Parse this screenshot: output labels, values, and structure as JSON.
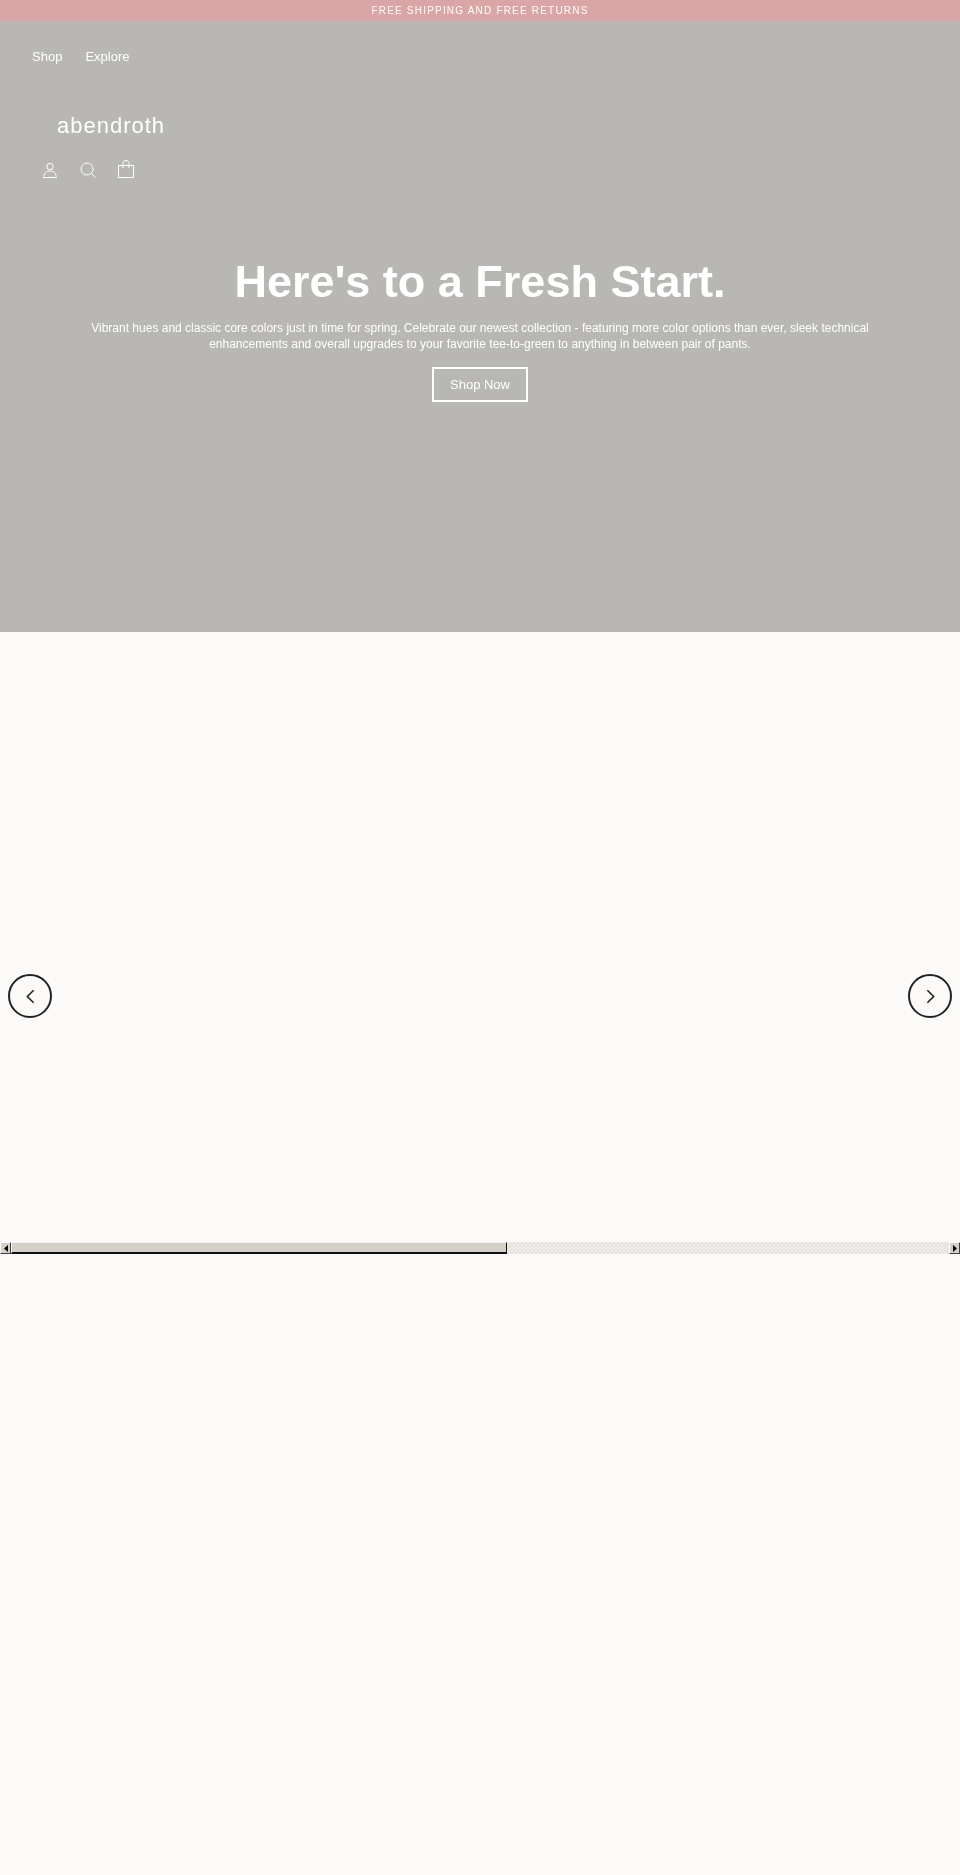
{
  "announcement_bar": {
    "text": "FREE SHIPPING AND FREE RETURNS"
  },
  "nav_links": [
    "Shop",
    "Explore"
  ],
  "header": {
    "logo": "abendroth"
  },
  "hero": {
    "heading": "Here's to a Fresh Start.",
    "text": "Vibrant hues and classic core colors just in time for spring. Celebrate our newest collection - featuring more color options than ever, sleek technical enhancements and overall upgrades to your favorite tee-to-green to anything in between pair of pants.",
    "button": "Shop Now"
  }
}
